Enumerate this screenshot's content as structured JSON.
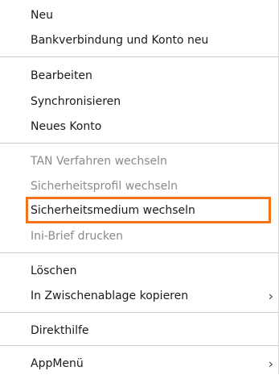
{
  "menu": {
    "items": [
      {
        "label": "Neu"
      },
      {
        "label": "Bankverbindung und Konto neu"
      },
      {
        "label": "Bearbeiten"
      },
      {
        "label": "Synchronisieren"
      },
      {
        "label": "Neues Konto"
      },
      {
        "label": "TAN Verfahren wechseln",
        "enabled": false
      },
      {
        "label": "Sicherheitsprofil wechseln",
        "enabled": false
      },
      {
        "label": "Sicherheitsmedium wechseln",
        "highlighted": true
      },
      {
        "label": "Ini-Brief drucken",
        "enabled": false
      },
      {
        "label": "Löschen"
      },
      {
        "label": "In Zwischenablage kopieren",
        "submenu_arrow": "›"
      },
      {
        "label": "Direkthilfe"
      },
      {
        "label": "AppMenü",
        "submenu_arrow": "›"
      }
    ],
    "highlight_color": "#f2741a",
    "disabled_text_color": "#8a8a8a"
  }
}
